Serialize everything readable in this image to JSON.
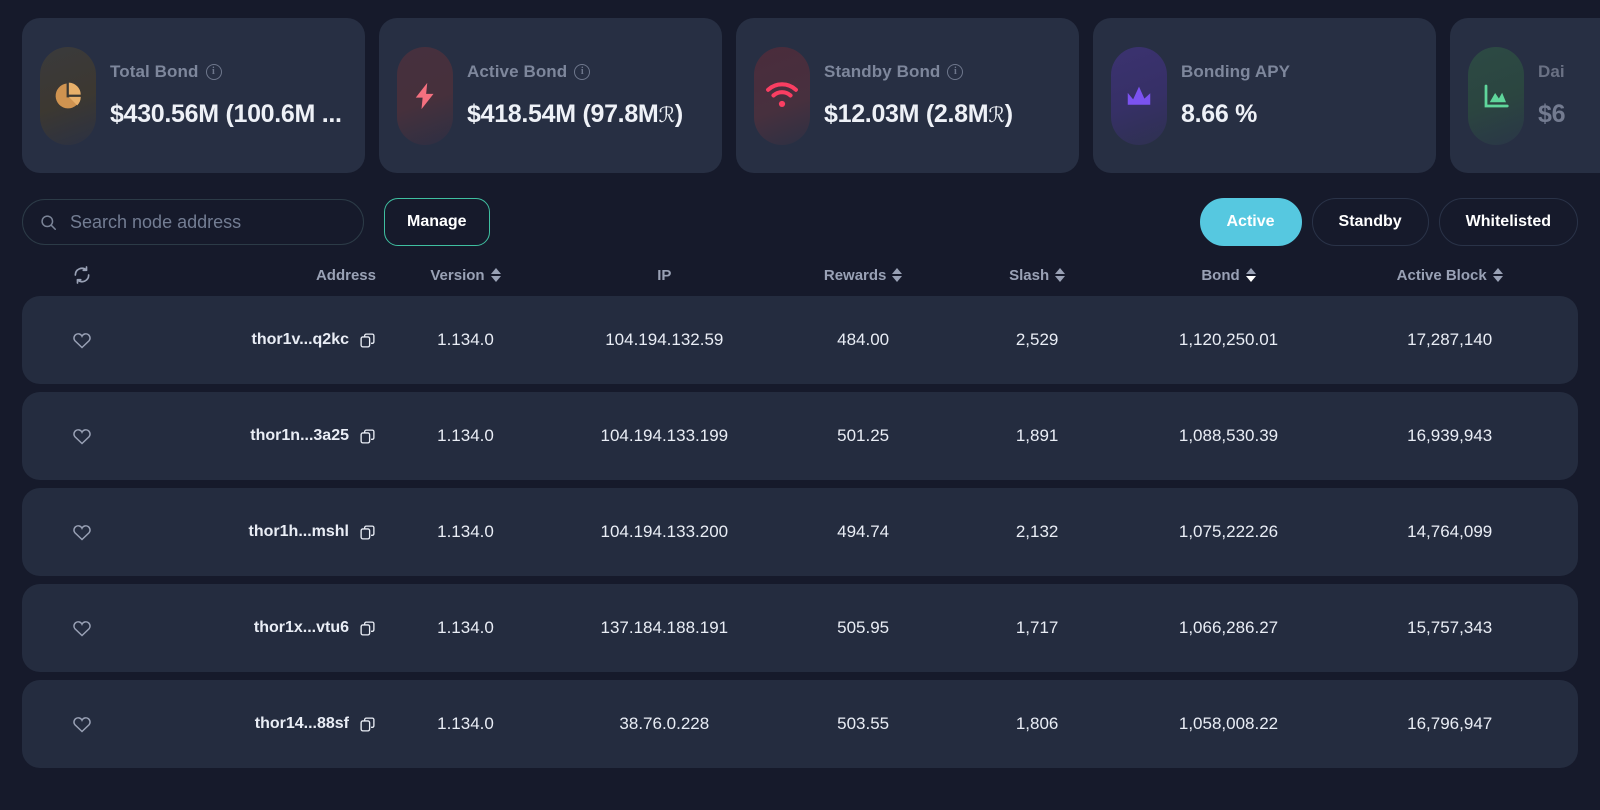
{
  "theme": {
    "page_bg": "#161a2b",
    "card_bg": "#272f43",
    "row_bg": "#242c3f",
    "accent_cyan": "#56c8e0",
    "accent_teal": "#3fbfa0",
    "text_primary": "#e9edf5",
    "text_muted": "#7e879c"
  },
  "stats": [
    {
      "label": "Total Bond",
      "value": "$430.56M (100.6M ...",
      "icon": "pie-chart-icon",
      "icon_color": "#e0a458",
      "has_info": true
    },
    {
      "label": "Active Bond",
      "value": "$418.54M (97.8M",
      "value_suffix": ")",
      "rune": "ℛ",
      "icon": "lightning-bolt-icon",
      "icon_color": "#f4707f",
      "has_info": true
    },
    {
      "label": "Standby Bond",
      "value": "$12.03M (2.8M",
      "value_suffix": ")",
      "rune": "ℛ",
      "icon": "wifi-icon",
      "icon_color": "#fa3e62",
      "has_info": true
    },
    {
      "label": "Bonding APY",
      "value": "8.66 %",
      "icon": "trending-chart-icon",
      "icon_color": "#7b52f0",
      "has_info": false
    },
    {
      "label": "Dai",
      "value": "$6",
      "icon": "area-chart-icon",
      "icon_color": "#5fd69b",
      "has_info": false
    }
  ],
  "search": {
    "placeholder": "Search node address",
    "value": "",
    "icon": "search-icon"
  },
  "manage_button": "Manage",
  "filters": [
    {
      "label": "Active",
      "active": true
    },
    {
      "label": "Standby",
      "active": false
    },
    {
      "label": "Whitelisted",
      "active": false
    }
  ],
  "table": {
    "refresh_icon": "refresh-icon",
    "columns": [
      {
        "key": "fav",
        "label": "",
        "sortable": false
      },
      {
        "key": "addr",
        "label": "Address",
        "sortable": false
      },
      {
        "key": "ver",
        "label": "Version",
        "sortable": true,
        "sort": "none"
      },
      {
        "key": "ip",
        "label": "IP",
        "sortable": false
      },
      {
        "key": "rew",
        "label": "Rewards",
        "sortable": true,
        "sort": "none"
      },
      {
        "key": "slash",
        "label": "Slash",
        "sortable": true,
        "sort": "none"
      },
      {
        "key": "bond",
        "label": "Bond",
        "sortable": true,
        "sort": "desc"
      },
      {
        "key": "blk",
        "label": "Active Block",
        "sortable": true,
        "sort": "none"
      }
    ],
    "rows": [
      {
        "address": "thor1v...q2kc",
        "version": "1.134.0",
        "ip": "104.194.132.59",
        "rewards": "484.00",
        "slash": "2,529",
        "bond": "1,120,250.01",
        "active_block": "17,287,140",
        "favorited": false
      },
      {
        "address": "thor1n...3a25",
        "version": "1.134.0",
        "ip": "104.194.133.199",
        "rewards": "501.25",
        "slash": "1,891",
        "bond": "1,088,530.39",
        "active_block": "16,939,943",
        "favorited": false
      },
      {
        "address": "thor1h...mshl",
        "version": "1.134.0",
        "ip": "104.194.133.200",
        "rewards": "494.74",
        "slash": "2,132",
        "bond": "1,075,222.26",
        "active_block": "14,764,099",
        "favorited": false
      },
      {
        "address": "thor1x...vtu6",
        "version": "1.134.0",
        "ip": "137.184.188.191",
        "rewards": "505.95",
        "slash": "1,717",
        "bond": "1,066,286.27",
        "active_block": "15,757,343",
        "favorited": false
      },
      {
        "address": "thor14...88sf",
        "version": "1.134.0",
        "ip": "38.76.0.228",
        "rewards": "503.55",
        "slash": "1,806",
        "bond": "1,058,008.22",
        "active_block": "16,796,947",
        "favorited": false
      }
    ]
  }
}
